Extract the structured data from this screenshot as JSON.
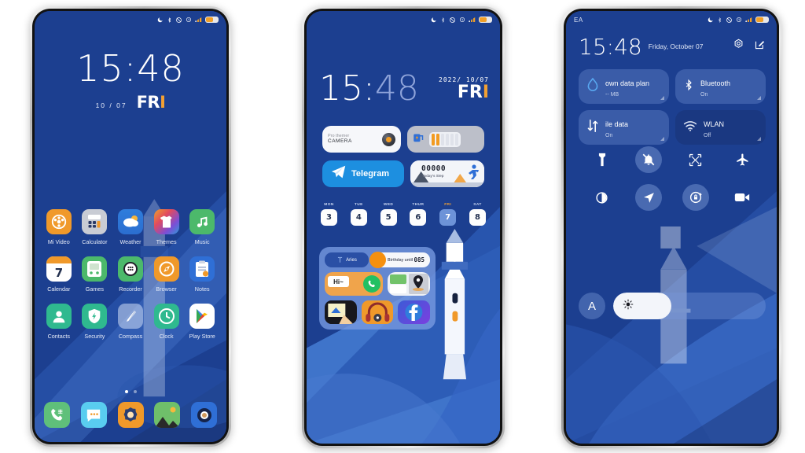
{
  "meta": {
    "accent_orange": "#f2a033",
    "bg_blue": "#1c3f90",
    "tile_blue": "#7898db"
  },
  "phone1": {
    "statusbar": {
      "icons": [
        "dnd-moon-icon",
        "bluetooth-icon",
        "sync-off-icon",
        "alarm-icon",
        "signal-icon",
        "battery-icon"
      ]
    },
    "clock": {
      "time": "15:48",
      "date": "10 / 07",
      "day_white": "FR",
      "day_orange": "I"
    },
    "apps": [
      {
        "label": "Mi Video",
        "icon": "mi-video-icon"
      },
      {
        "label": "Calculator",
        "icon": "calculator-icon"
      },
      {
        "label": "Weather",
        "icon": "weather-icon"
      },
      {
        "label": "Themes",
        "icon": "themes-icon"
      },
      {
        "label": "Music",
        "icon": "music-icon"
      },
      {
        "label": "Calendar",
        "icon": "calendar-icon"
      },
      {
        "label": "Games",
        "icon": "games-icon"
      },
      {
        "label": "Recorder",
        "icon": "recorder-icon"
      },
      {
        "label": "Browser",
        "icon": "browser-icon"
      },
      {
        "label": "Notes",
        "icon": "notes-icon"
      },
      {
        "label": "Contacts",
        "icon": "contacts-icon"
      },
      {
        "label": "Security",
        "icon": "security-icon"
      },
      {
        "label": "Compass",
        "icon": "compass-icon"
      },
      {
        "label": "Clock",
        "icon": "clock-icon"
      },
      {
        "label": "Play Store",
        "icon": "play-store-icon"
      }
    ],
    "dock": [
      {
        "icon": "phone-dialer-icon"
      },
      {
        "icon": "messages-icon"
      },
      {
        "icon": "settings-icon"
      },
      {
        "icon": "gallery-icon"
      },
      {
        "icon": "camera-icon"
      }
    ],
    "page_dots": {
      "count": 2,
      "active": 0
    }
  },
  "phone2": {
    "clock": {
      "time_bright": "15",
      "time_sep": ":",
      "time_dim": "48",
      "date": "2022/ 10/07",
      "day_white": "FR",
      "day_orange": "I"
    },
    "widgets": {
      "camera": {
        "title": "Pro themer",
        "subtitle": "CAMERA",
        "icon": "camera-lens-icon"
      },
      "battery": {
        "icon": "battery-charge-icon",
        "cells_total": 6,
        "cells_filled": 2
      },
      "telegram": {
        "label": "Telegram",
        "icon": "telegram-icon"
      },
      "steps": {
        "value": "00000",
        "caption": "Today's Step",
        "icon": "runner-icon"
      }
    },
    "week": {
      "days": [
        {
          "name": "MON",
          "num": "3",
          "selected": false
        },
        {
          "name": "TUE",
          "num": "4",
          "selected": false
        },
        {
          "name": "WED",
          "num": "5",
          "selected": false
        },
        {
          "name": "THUR",
          "num": "6",
          "selected": false
        },
        {
          "name": "FRI",
          "num": "7",
          "selected": true
        },
        {
          "name": "SAT",
          "num": "8",
          "selected": false
        }
      ]
    },
    "folder": {
      "zodiac": {
        "label": "Aries",
        "icon": "aries-icon"
      },
      "birthday": {
        "label": "Birthday until",
        "value": "085"
      },
      "apps": [
        {
          "icon": "whatsapp-hi-icon",
          "text": "Hi~"
        },
        {
          "icon": "maps-icon"
        },
        {
          "icon": "photo-edit-icon"
        },
        {
          "icon": "headphones-music-icon"
        },
        {
          "icon": "facebook-icon"
        }
      ]
    }
  },
  "phone3": {
    "statusbar": {
      "carrier": "EA"
    },
    "header": {
      "time": "15:48",
      "date": "Friday, October 07",
      "actions": [
        {
          "icon": "settings-gear-icon"
        },
        {
          "icon": "edit-icon"
        }
      ]
    },
    "tiles": [
      {
        "title": "own data plan",
        "subtitle": "-- MB",
        "icon": "data-usage-icon",
        "state": "on"
      },
      {
        "title": "Bluetooth",
        "subtitle": "On",
        "icon": "bluetooth-icon",
        "state": "on"
      },
      {
        "title": "ile data",
        "subtitle": "On",
        "icon": "mobile-data-icon",
        "state": "on"
      },
      {
        "title": "WLAN",
        "subtitle": "Off",
        "icon": "wifi-icon",
        "state": "off"
      }
    ],
    "toggles": [
      {
        "icon": "flashlight-icon",
        "active": false
      },
      {
        "icon": "mute-bell-icon",
        "active": true
      },
      {
        "icon": "screenshot-icon",
        "active": false
      },
      {
        "icon": "airplane-icon",
        "active": false
      },
      {
        "icon": "dark-mode-icon",
        "active": false
      },
      {
        "icon": "location-icon",
        "active": true
      },
      {
        "icon": "rotation-lock-icon",
        "active": true
      },
      {
        "icon": "screen-record-icon",
        "active": false
      }
    ],
    "brightness": {
      "auto_label": "A",
      "icon": "brightness-icon",
      "percent": 38
    }
  }
}
